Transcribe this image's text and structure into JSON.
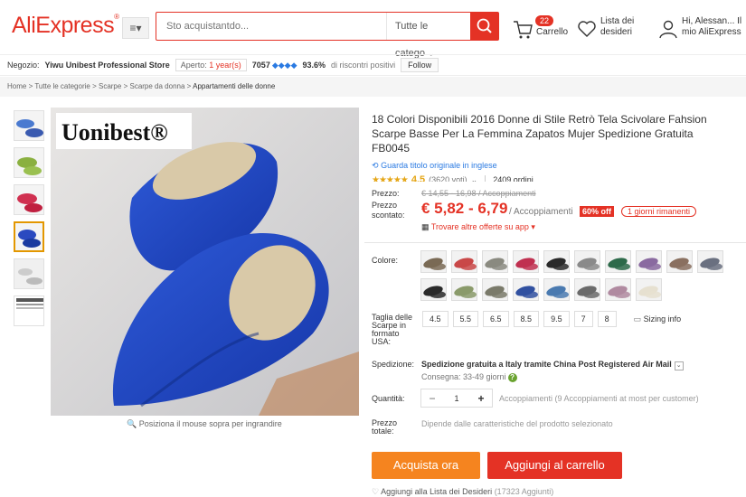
{
  "header": {
    "logo": "AliExpress",
    "categories_button": "≡▾",
    "search": {
      "placeholder": "Sto acquistantdo...",
      "category": "Tutte le catego"
    },
    "cart": {
      "count": "22",
      "label": "Carrello"
    },
    "wishlist": {
      "label": "Lista dei desideri"
    },
    "user": {
      "label": "Hi, Alessan... Il mio AliExpress"
    }
  },
  "store": {
    "prefix": "Negozio:",
    "name": "Yiwu Unibest Professional Store",
    "open_prefix": "Aperto:",
    "open_value": "1 year(s)",
    "score": "7057",
    "positive": "93.6%",
    "positive_label": "di riscontri positivi",
    "follow": "Follow"
  },
  "breadcrumb": {
    "home": "Home",
    "all": "Tutte le categorie",
    "shoes": "Scarpe",
    "women": "Scarpe da donna",
    "last": "Appartamenti delle donne",
    "sep": ">"
  },
  "product": {
    "brand": "Uonibest",
    "zoom_hint": "Posiziona il mouse sopra per ingrandire",
    "title": "18 Colori Disponibili 2016 Donne di Stile Retrò Tela Scivolare Fahsion Scarpe Basse Per La Femmina Zapatos Mujer Spedizione Gratuita FB0045",
    "original_title_link": "Guarda titolo originale in inglese",
    "rating": "4.5",
    "votes": "(3620 voti)",
    "orders": "2409 ordini"
  },
  "pricing": {
    "price_label": "Prezzo:",
    "old_price": "€ 14,55 - 16,98 / Accoppiamenti",
    "discount_label": "Prezzo scontato:",
    "new_price": "€ 5,82 - 6,79",
    "unit": "/ Accoppiamenti",
    "off": "60% off",
    "days": "1 giorni rimanenti",
    "app": "Trovare altre offerte su app ▾"
  },
  "options": {
    "color_label": "Colore:",
    "colors": [
      "#7a6a55",
      "#c94848",
      "#8a8a80",
      "#c03050",
      "#2a2a2a",
      "#8a8a8a",
      "#2d6a4a",
      "#8a6aa0",
      "#8a7060",
      "#6a7080",
      "#2a2a2a",
      "#8a9a6a",
      "#7a7a6a",
      "#3050a0",
      "#4a7ab0",
      "#6a6a6a",
      "#b08aa0",
      "#e6e0d0"
    ],
    "size_label": "Taglia delle Scarpe in formato USA:",
    "sizes": [
      "4.5",
      "5.5",
      "6.5",
      "8.5",
      "9.5",
      "7",
      "8"
    ],
    "size_info": "Sizing info",
    "shipping_label": "Spedizione:",
    "shipping": "Spedizione gratuita a Italy tramite China Post Registered Air Mail",
    "delivery": "Consegna: 33-49 giorni",
    "qty_label": "Quantità:",
    "qty_value": "1",
    "qty_info": "Accoppiamenti (9 Accoppiamenti at most per customer)",
    "total_label": "Prezzo totale:",
    "total_value": "Dipende dalle caratteristiche del prodotto selezionato"
  },
  "actions": {
    "buy": "Acquista ora",
    "add_cart": "Aggiungi al carrello",
    "wishlist": "Aggiungi alla Lista dei Desideri",
    "wish_count": "(17323 Aggiunti)"
  }
}
